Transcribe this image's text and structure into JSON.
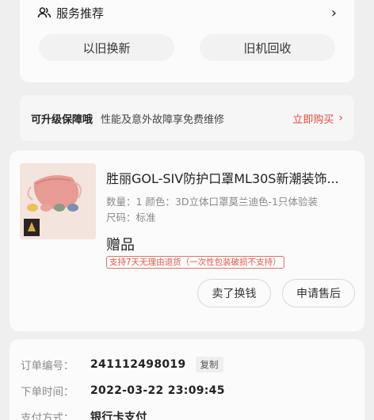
{
  "services": {
    "title": "服务推荐",
    "icon": "people-icon",
    "chevron": "›",
    "buttons": [
      "以旧换新",
      "旧机回收"
    ]
  },
  "upgrade": {
    "title": "可升级保障哦",
    "description": "性能及意外故障享免费维修",
    "buy_label": "立即购买",
    "chevron": "›",
    "accent_color": "#e34a3c"
  },
  "product": {
    "title": "胜丽GOL-SIV防护口罩ML30S新潮装饰...",
    "meta_line1": "数量：1  颜色：3D立体口罩莫兰迪色-1只体验装",
    "meta_line2": "尺码：标准",
    "gift_label": "赠品",
    "badge": "支持7天无理由退货（一次性包装破损不支持）",
    "actions": {
      "sell": "卖了换钱",
      "after_sale": "申请售后"
    }
  },
  "order": {
    "number_label": "订单编号：",
    "number_value": "241112498019",
    "copy_label": "复制",
    "time_label": "下单时间：",
    "time_value": "2022-03-22 23:09:45",
    "payment_label": "支付方式：",
    "payment_value": "银行卡支付"
  }
}
